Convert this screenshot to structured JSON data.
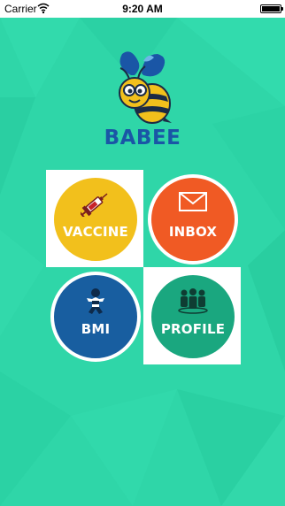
{
  "status_bar": {
    "carrier": "Carrier",
    "time": "9:20 AM",
    "wifi_icon": "wifi-icon",
    "battery_icon": "battery-icon"
  },
  "app": {
    "logo_text": "BABEE",
    "logo_icon": "bee-icon"
  },
  "menu": {
    "vaccine_label": "VACCINE",
    "inbox_label": "INBOX",
    "bmi_label": "BMI",
    "profile_label": "PROFILE",
    "vaccine_icon": "syringe-icon",
    "inbox_icon": "envelope-icon",
    "bmi_icon": "baby-icon",
    "profile_icon": "group-icon"
  },
  "colors": {
    "background": "#2fd6a8",
    "vaccine": "#f2c01c",
    "inbox": "#f05a24",
    "bmi": "#185ea0",
    "profile": "#1aa77f",
    "logo_text": "#1a56a6"
  }
}
